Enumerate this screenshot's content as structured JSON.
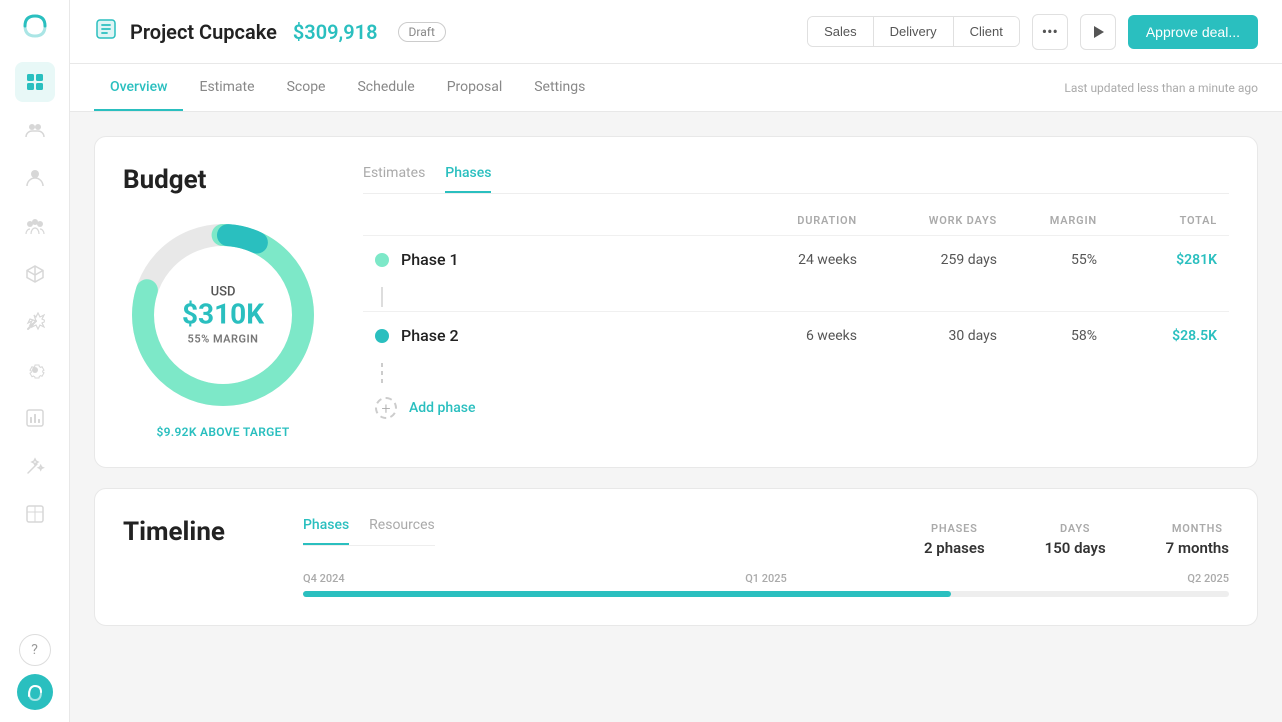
{
  "sidebar": {
    "logo_icon": "~",
    "items": [
      {
        "id": "grid",
        "icon": "⊞",
        "active": true
      },
      {
        "id": "people",
        "icon": "👥",
        "active": false
      },
      {
        "id": "person",
        "icon": "👤",
        "active": false
      },
      {
        "id": "group",
        "icon": "👨‍👩‍👧‍👦",
        "active": false
      },
      {
        "id": "box",
        "icon": "📦",
        "active": false
      },
      {
        "id": "magic",
        "icon": "✨",
        "active": false
      },
      {
        "id": "gear",
        "icon": "⚙",
        "active": false
      },
      {
        "id": "report",
        "icon": "📊",
        "active": false
      },
      {
        "id": "wand",
        "icon": "🪄",
        "active": false
      },
      {
        "id": "table",
        "icon": "▦",
        "active": false
      }
    ],
    "bottom_items": [
      {
        "id": "help",
        "icon": "?"
      },
      {
        "id": "avatar",
        "icon": "~"
      }
    ]
  },
  "topbar": {
    "project_icon": "📋",
    "project_name": "Project Cupcake",
    "project_amount": "$309,918",
    "draft_label": "Draft",
    "tab_group": {
      "sales_label": "Sales",
      "delivery_label": "Delivery",
      "client_label": "Client"
    },
    "more_icon": "•••",
    "play_icon": "▶",
    "approve_label": "Approve deal..."
  },
  "nav": {
    "tabs": [
      {
        "id": "overview",
        "label": "Overview",
        "active": true
      },
      {
        "id": "estimate",
        "label": "Estimate",
        "active": false
      },
      {
        "id": "scope",
        "label": "Scope",
        "active": false
      },
      {
        "id": "schedule",
        "label": "Schedule",
        "active": false
      },
      {
        "id": "proposal",
        "label": "Proposal",
        "active": false
      },
      {
        "id": "settings",
        "label": "Settings",
        "active": false
      }
    ],
    "last_updated": "Last updated less than a minute ago"
  },
  "budget": {
    "title": "Budget",
    "donut": {
      "currency": "USD",
      "amount": "$310K",
      "margin_label": "55% MARGIN"
    },
    "above_target_amount": "$9.92K",
    "above_target_label": "ABOVE TARGET",
    "tabs": [
      {
        "id": "estimates",
        "label": "Estimates",
        "active": false
      },
      {
        "id": "phases",
        "label": "Phases",
        "active": true
      }
    ],
    "table_headers": {
      "phase": "",
      "duration": "DURATION",
      "work_days": "WORK DAYS",
      "margin": "MARGIN",
      "total": "TOTAL"
    },
    "phases": [
      {
        "name": "Phase 1",
        "dot_style": "light",
        "duration": "24 weeks",
        "work_days": "259 days",
        "margin": "55%",
        "total": "$281K"
      },
      {
        "name": "Phase 2",
        "dot_style": "dark",
        "duration": "6 weeks",
        "work_days": "30 days",
        "margin": "58%",
        "total": "$28.5K"
      }
    ],
    "add_phase_label": "Add phase"
  },
  "timeline": {
    "title": "Timeline",
    "tabs": [
      {
        "id": "phases",
        "label": "Phases",
        "active": true
      },
      {
        "id": "resources",
        "label": "Resources",
        "active": false
      }
    ],
    "stats": {
      "phases_label": "PHASES",
      "phases_value": "2 phases",
      "days_label": "DAYS",
      "days_value": "150 days",
      "months_label": "MONTHS",
      "months_value": "7 months"
    },
    "quarters": [
      "Q4 2024",
      "Q1 2025",
      "Q2 2025"
    ]
  }
}
